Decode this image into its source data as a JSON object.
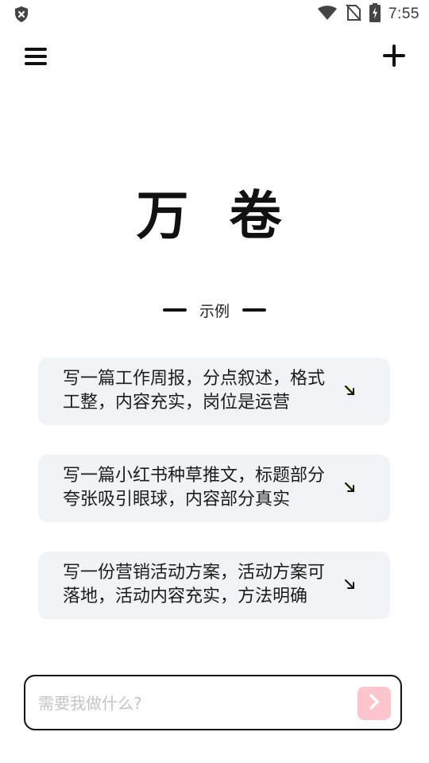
{
  "status_bar": {
    "time": "7:55",
    "icons": [
      "shield-x-icon",
      "wifi-icon",
      "no-sim-icon",
      "battery-charging-icon"
    ]
  },
  "app_bar": {
    "menu_icon": "hamburger-menu-icon",
    "add_icon": "plus-icon"
  },
  "main": {
    "title": "万 卷",
    "examples_label": "示例",
    "examples": [
      {
        "text": "写一篇工作周报，分点叙述，格式工整，内容充实，岗位是运营",
        "arrow_icon": "arrow-down-right-icon",
        "arrow_accent": "#c8e000"
      },
      {
        "text": "写一篇小红书种草推文，标题部分夸张吸引眼球，内容部分真实",
        "arrow_icon": "arrow-down-right-icon",
        "arrow_accent": "#c8e000"
      },
      {
        "text": "写一份营销活动方案，活动方案可落地，活动内容充实，方法明确",
        "arrow_icon": "arrow-down-right-icon",
        "arrow_accent": "#ffffff"
      }
    ]
  },
  "composer": {
    "placeholder": "需要我做什么?",
    "value": "",
    "send_icon": "chevron-right-icon",
    "send_color": "#ffc5cc"
  }
}
